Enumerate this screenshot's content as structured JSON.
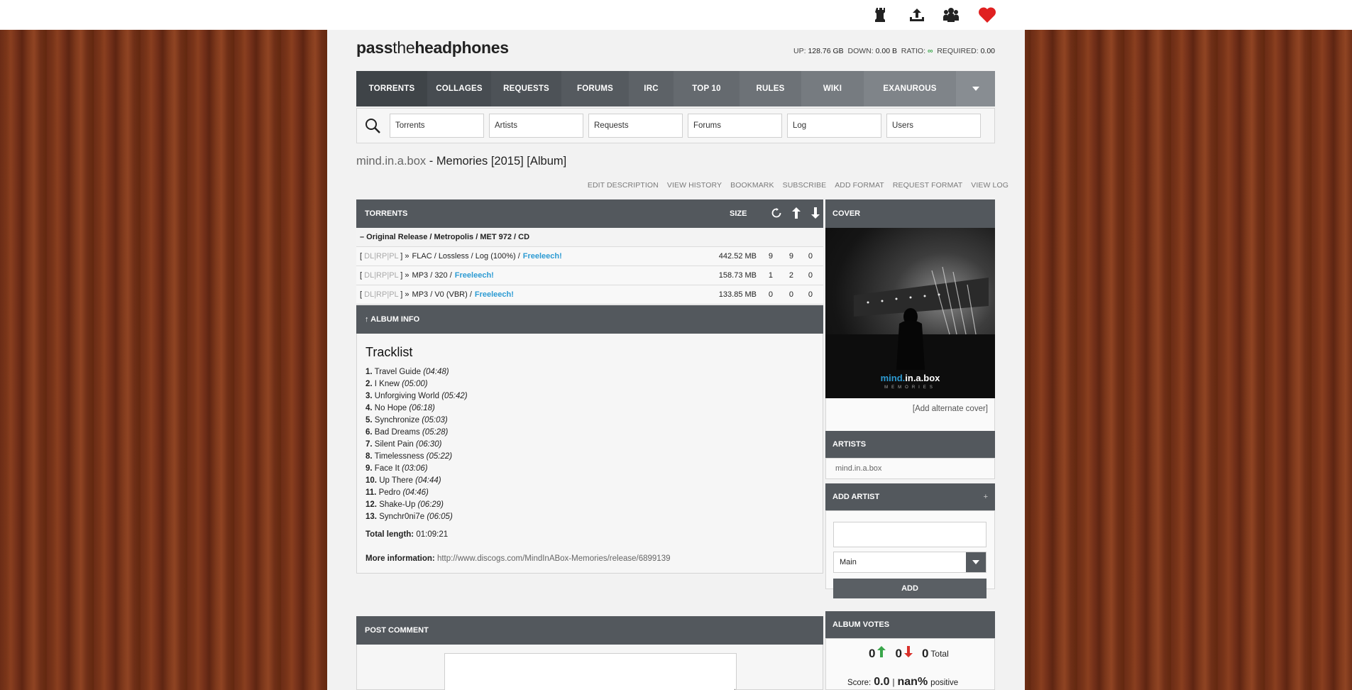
{
  "topbar": {
    "icons": [
      "chess-rook-icon",
      "upload-icon",
      "users-icon",
      "heart-icon"
    ]
  },
  "site": {
    "logo_bold1": "pass",
    "logo_thin": "the",
    "logo_bold2": "headphones"
  },
  "stats": {
    "up_label": "UP:",
    "up_value": "128.76 GB",
    "down_label": "DOWN:",
    "down_value": "0.00 B",
    "ratio_label": "RATIO:",
    "ratio_value": "∞",
    "required_label": "REQUIRED:",
    "required_value": "0.00"
  },
  "nav": {
    "items": [
      "TORRENTS",
      "COLLAGES",
      "REQUESTS",
      "FORUMS",
      "IRC",
      "TOP 10",
      "RULES",
      "WIKI",
      "EXANUROUS"
    ],
    "colors": [
      "#3f4448",
      "#474c51",
      "#4d5257",
      "#555a5f",
      "#5d6267",
      "#656a6f",
      "#6d7277",
      "#767b80",
      "#7f8489",
      "#888d92"
    ]
  },
  "search": {
    "placeholders": [
      "Torrents",
      "Artists",
      "Requests",
      "Forums",
      "Log",
      "Users"
    ]
  },
  "album": {
    "artist": "mind.in.a.box",
    "separator": " - ",
    "name": "Memories [2015] [Album]"
  },
  "links": [
    "EDIT DESCRIPTION",
    "VIEW HISTORY",
    "BOOKMARK",
    "SUBSCRIBE",
    "ADD FORMAT",
    "REQUEST FORMAT",
    "VIEW LOG"
  ],
  "torrents": {
    "header": "TORRENTS",
    "size_header": "SIZE",
    "edition": "– Original Release / Metropolis / MET 972 / CD",
    "rows": [
      {
        "format": "FLAC / Lossless / Log (100%) /",
        "free": "Freeleech!",
        "size": "442.52 MB",
        "snatches": "9",
        "seeders": "9",
        "leechers": "0"
      },
      {
        "format": "MP3 / 320 /",
        "free": "Freeleech!",
        "size": "158.73 MB",
        "snatches": "1",
        "seeders": "2",
        "leechers": "0"
      },
      {
        "format": "MP3 / V0 (VBR) /",
        "free": "Freeleech!",
        "size": "133.85 MB",
        "snatches": "0",
        "seeders": "0",
        "leechers": "0"
      }
    ],
    "row_prefix_open": "[",
    "dl": "DL",
    "rp": "RP",
    "pl": "PL",
    "row_prefix_close": "] »",
    "pipe": "|"
  },
  "album_info": {
    "header": "↑ ALBUM INFO",
    "tracklist_title": "Tracklist",
    "tracks": [
      {
        "num": "1.",
        "title": "Travel Guide",
        "time": "(04:48)"
      },
      {
        "num": "2.",
        "title": "I Knew",
        "time": "(05:00)"
      },
      {
        "num": "3.",
        "title": "Unforgiving World",
        "time": "(05:42)"
      },
      {
        "num": "4.",
        "title": "No Hope",
        "time": "(06:18)"
      },
      {
        "num": "5.",
        "title": "Synchronize",
        "time": "(05:03)"
      },
      {
        "num": "6.",
        "title": "Bad Dreams",
        "time": "(05:28)"
      },
      {
        "num": "7.",
        "title": "Silent Pain",
        "time": "(06:30)"
      },
      {
        "num": "8.",
        "title": "Timelessness",
        "time": "(05:22)"
      },
      {
        "num": "9.",
        "title": "Face It",
        "time": "(03:06)"
      },
      {
        "num": "10.",
        "title": "Up There",
        "time": "(04:44)"
      },
      {
        "num": "11.",
        "title": "Pedro",
        "time": "(04:46)"
      },
      {
        "num": "12.",
        "title": "Shake-Up",
        "time": "(06:29)"
      },
      {
        "num": "13.",
        "title": "Synchr0ni7e",
        "time": "(06:05)"
      }
    ],
    "total_label": "Total length:",
    "total_value": "01:09:21",
    "more_label": "More information:",
    "more_url": "http://www.discogs.com/MindInABox-Memories/release/6899139"
  },
  "post_comment": {
    "header": "POST COMMENT"
  },
  "cover": {
    "header": "COVER",
    "logo_blue": "mind.",
    "logo_white": "in.a.box",
    "subtitle": "MEMORIES",
    "add_alternate": "[Add alternate cover]"
  },
  "artists": {
    "header": "ARTISTS",
    "name": "mind.in.a.box"
  },
  "add_artist": {
    "header": "ADD ARTIST",
    "plus": "+",
    "select_value": "Main",
    "button": "ADD"
  },
  "votes": {
    "header": "ALBUM VOTES",
    "up_count": "0",
    "down_count": "0",
    "total_count": "0",
    "total_label": "Total",
    "score_label": "Score:",
    "score_value": "0.0",
    "pct_value": "nan%",
    "pct_label": "positive"
  },
  "colors": {
    "accent_blue": "#2d9bd3",
    "heart_red": "#e02020",
    "vote_up": "#3aa64b",
    "vote_down": "#d9302a"
  }
}
